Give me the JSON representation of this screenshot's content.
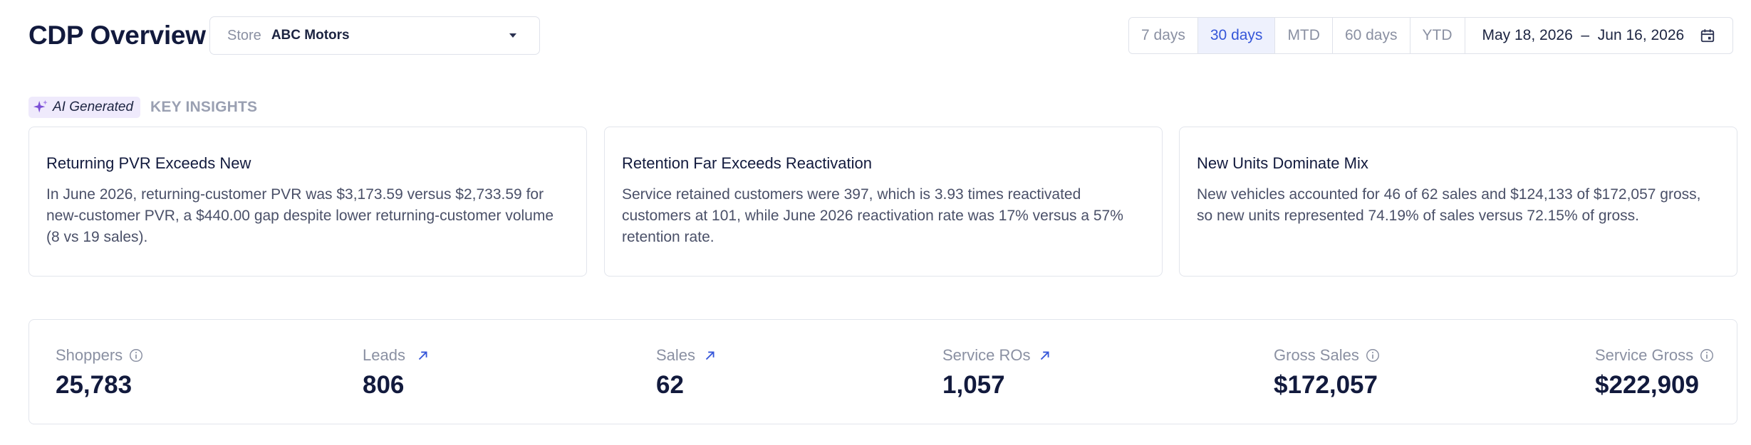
{
  "header": {
    "title": "CDP Overview",
    "store_label": "Store",
    "store_value": "ABC Motors",
    "ranges": [
      {
        "label": "7 days",
        "active": false
      },
      {
        "label": "30 days",
        "active": true
      },
      {
        "label": "MTD",
        "active": false
      },
      {
        "label": "60 days",
        "active": false
      },
      {
        "label": "YTD",
        "active": false
      }
    ],
    "date_range": "May 18, 2026  –  Jun 16, 2026"
  },
  "insights": {
    "badge": "AI Generated",
    "title": "KEY INSIGHTS",
    "cards": [
      {
        "title": "Returning PVR Exceeds New",
        "body": "In June 2026, returning-customer PVR was $3,173.59 versus $2,733.59 for new-customer PVR, a $440.00 gap despite lower returning-customer volume (8 vs 19 sales)."
      },
      {
        "title": "Retention Far Exceeds Reactivation",
        "body": "Service retained customers were 397, which is 3.93 times reactivated customers at 101, while June 2026 reactivation rate was 17% versus a 57% retention rate."
      },
      {
        "title": "New Units Dominate Mix",
        "body": "New vehicles accounted for 46 of 62 sales and $124,133 of $172,057 gross, so new units represented 74.19% of sales versus 72.15% of gross."
      }
    ]
  },
  "metrics": [
    {
      "label": "Shoppers",
      "value": "25,783",
      "icon": "info-icon"
    },
    {
      "label": "Leads",
      "value": "806",
      "icon": "arrow-up-right-icon"
    },
    {
      "label": "Sales",
      "value": "62",
      "icon": "arrow-up-right-icon"
    },
    {
      "label": "Service ROs",
      "value": "1,057",
      "icon": "arrow-up-right-icon"
    },
    {
      "label": "Gross Sales",
      "value": "$172,057",
      "icon": "info-icon"
    },
    {
      "label": "Service Gross",
      "value": "$222,909",
      "icon": "info-icon"
    }
  ],
  "colors": {
    "accent": "#3556d9",
    "active_bg": "#eef1fd",
    "ai_badge_bg": "#efeafc",
    "sparkle": "#7b4fd6"
  }
}
